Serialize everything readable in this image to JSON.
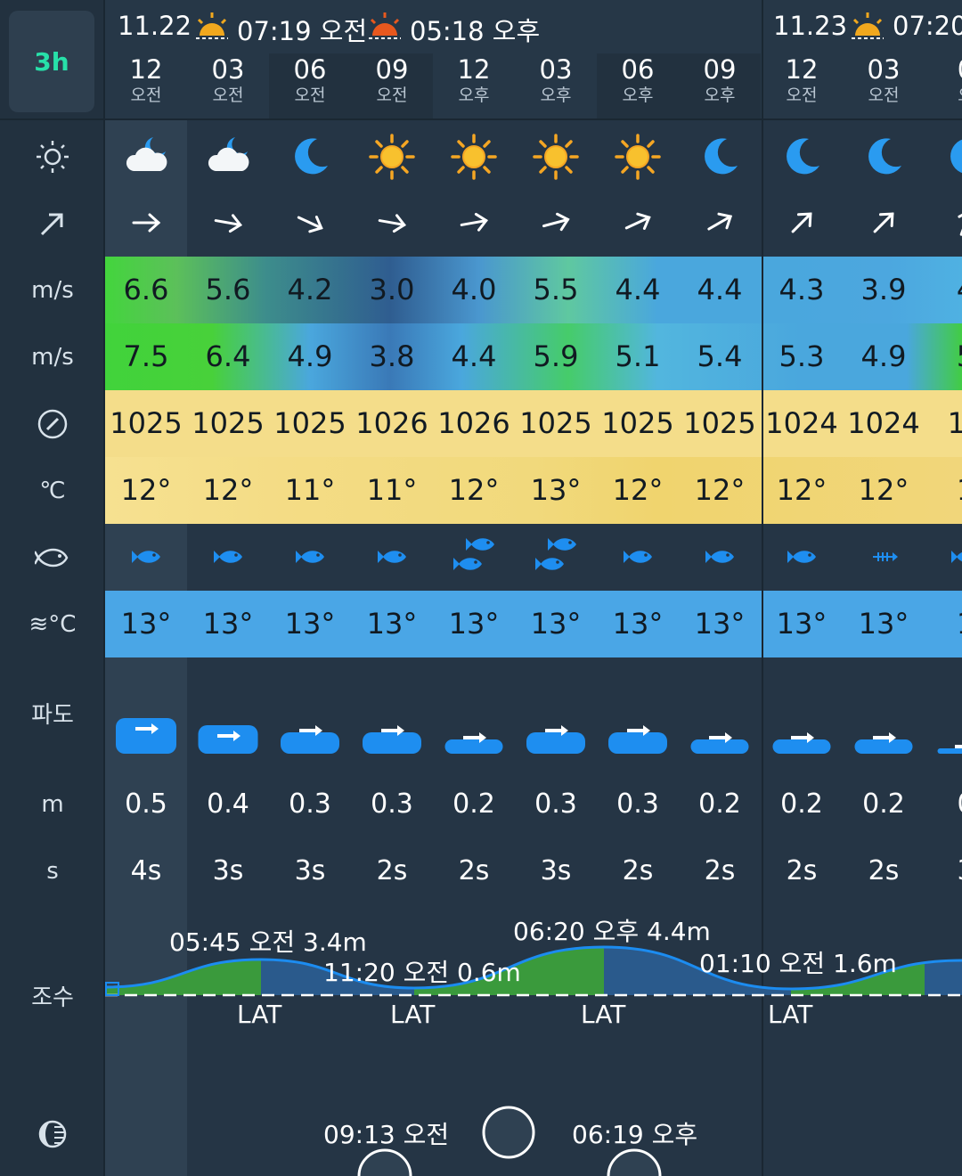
{
  "interval_label": "3h",
  "day1": {
    "date": "11.22",
    "sunrise": "07:19 오전",
    "sunset": "05:18 오후"
  },
  "day2": {
    "date": "11.23",
    "sunrise": "07:20"
  },
  "side_labels": {
    "weather": "sun-icon",
    "wind_dir": "arrow-icon",
    "wind": "m/s",
    "gust": "m/s",
    "pressure": "gauge-icon",
    "temp": "℃",
    "fish": "fish-icon",
    "water_temp": "≋°C",
    "wave": "파도",
    "wave_height_unit": "m",
    "wave_period_unit": "s",
    "tide": "조수",
    "moon": "moon-phase-icon"
  },
  "hours": [
    {
      "h": "12",
      "p": "오전"
    },
    {
      "h": "03",
      "p": "오전"
    },
    {
      "h": "06",
      "p": "오전"
    },
    {
      "h": "09",
      "p": "오전"
    },
    {
      "h": "12",
      "p": "오후"
    },
    {
      "h": "03",
      "p": "오후"
    },
    {
      "h": "06",
      "p": "오후"
    },
    {
      "h": "09",
      "p": "오후"
    },
    {
      "h": "12",
      "p": "오전"
    },
    {
      "h": "03",
      "p": "오전"
    },
    {
      "h": "0",
      "p": "오"
    }
  ],
  "weather_icons": [
    "cloud-moon-icon",
    "cloud-moon-icon",
    "moon-icon",
    "sun-icon",
    "sun-icon",
    "sun-icon",
    "sun-icon",
    "moon-icon",
    "moon-icon",
    "moon-icon",
    "moon-icon"
  ],
  "wind_dirs": [
    90,
    100,
    115,
    100,
    80,
    75,
    65,
    60,
    45,
    45,
    20
  ],
  "wind": [
    "6.6",
    "5.6",
    "4.2",
    "3.0",
    "4.0",
    "5.5",
    "4.4",
    "4.4",
    "4.3",
    "3.9",
    "4"
  ],
  "gust": [
    "7.5",
    "6.4",
    "4.9",
    "3.8",
    "4.4",
    "5.9",
    "5.1",
    "5.4",
    "5.3",
    "4.9",
    "5"
  ],
  "pressure": [
    "1025",
    "1025",
    "1025",
    "1026",
    "1026",
    "1025",
    "1025",
    "1025",
    "1024",
    "1024",
    "10"
  ],
  "temp": [
    "12°",
    "12°",
    "11°",
    "11°",
    "12°",
    "13°",
    "12°",
    "12°",
    "12°",
    "12°",
    "1"
  ],
  "fish": [
    1,
    1,
    1,
    1,
    2,
    2,
    1,
    1,
    1,
    0,
    1
  ],
  "water_temp": [
    "13°",
    "13°",
    "13°",
    "13°",
    "13°",
    "13°",
    "13°",
    "13°",
    "13°",
    "13°",
    "1"
  ],
  "wave_height": [
    "0.5",
    "0.4",
    "0.3",
    "0.3",
    "0.2",
    "0.3",
    "0.3",
    "0.2",
    "0.2",
    "0.2",
    "0"
  ],
  "wave_period": [
    "4s",
    "3s",
    "3s",
    "2s",
    "2s",
    "3s",
    "2s",
    "2s",
    "2s",
    "2s",
    "3"
  ],
  "tide": {
    "events": [
      {
        "label": "05:45 오전 3.4m"
      },
      {
        "label": "11:20 오전 0.6m"
      },
      {
        "label": "06:20 오후 4.4m"
      },
      {
        "label": "01:10 오전 1.6m"
      }
    ],
    "lat_label": "LAT"
  },
  "moon": {
    "moonrise": "09:13 오전",
    "moonset": "06:19 오후"
  },
  "colors": {
    "accent": "#27e0a9",
    "wind_green": "#41d33b",
    "pressure_yellow": "#f4dc85",
    "water_blue": "#4aa6e6",
    "fish_blue": "#1e8ef0"
  }
}
